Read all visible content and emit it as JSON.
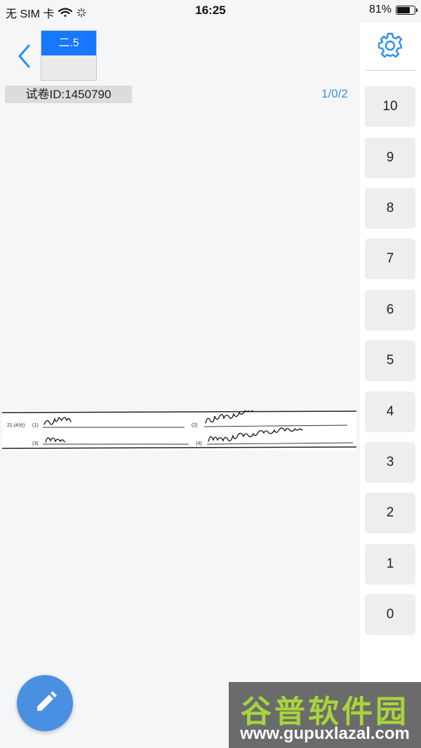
{
  "status_bar": {
    "carrier": "无 SIM 卡",
    "time": "16:25",
    "battery": "81%",
    "battery_level": 0.81
  },
  "header": {
    "question_tab_label": "二.5",
    "paper_id": "试卷ID:1450790",
    "page_counter": "1/0/2"
  },
  "score_panel": {
    "buttons": [
      "10",
      "9",
      "8",
      "7",
      "6",
      "5",
      "4",
      "3",
      "2",
      "1",
      "0"
    ]
  },
  "answer_strip": {
    "question_number": "21.(4分)",
    "markers": [
      "(1)",
      "(2)",
      "(3)",
      "(4)"
    ]
  },
  "watermark": {
    "text": "谷普软件园",
    "url": "www.gupuxlazal.com"
  },
  "icons": {
    "back": "chevron-left-icon",
    "settings": "gear-icon",
    "edit": "pencil-icon",
    "wifi": "wifi-icon",
    "loading": "loading-spinner-icon"
  },
  "colors": {
    "accent": "#1677ff",
    "link": "#3d8ee9",
    "fab": "#4a90e2",
    "watermark_green": "#a8d43b"
  }
}
